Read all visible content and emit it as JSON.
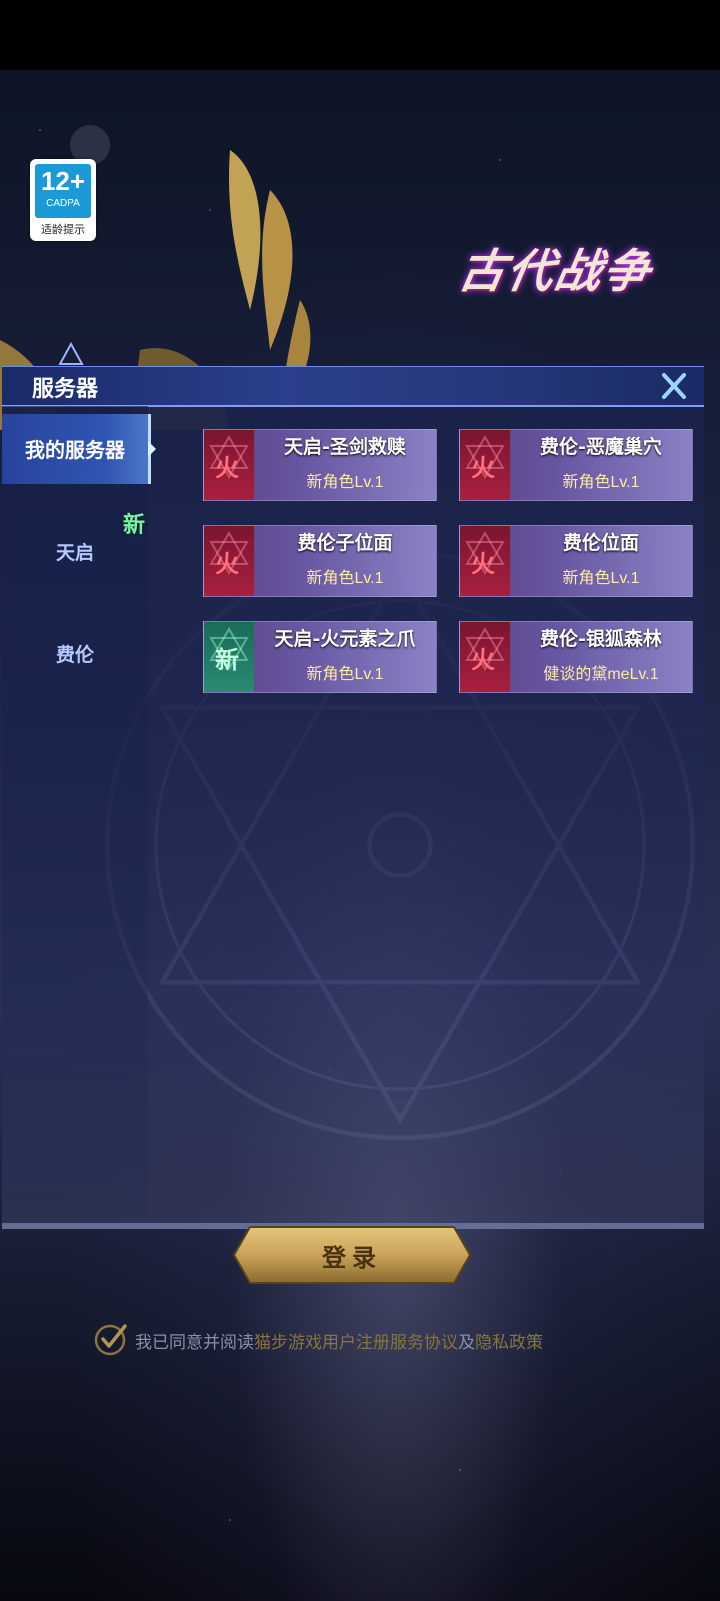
{
  "age_rating": {
    "number": "12+",
    "org": "CADPA",
    "tip": "适龄提示"
  },
  "game_logo": "古代战争",
  "panel": {
    "title": "服务器",
    "sidebar": [
      {
        "label": "我的服务器",
        "active": true
      },
      {
        "label": "天启",
        "active": false
      },
      {
        "label": "费伦",
        "active": false
      }
    ],
    "new_tag": "新",
    "servers": [
      {
        "name": "天启-圣剑救赎",
        "badge": "火",
        "role": "新角色Lv.1"
      },
      {
        "name": "费伦-恶魔巢穴",
        "badge": "火",
        "role": "新角色Lv.1"
      },
      {
        "name": "费伦子位面",
        "badge": "火",
        "role": "新角色Lv.1"
      },
      {
        "name": "费伦位面",
        "badge": "火",
        "role": "新角色Lv.1"
      },
      {
        "name": "天启-火元素之爪",
        "badge": "新",
        "role": "新角色Lv.1"
      },
      {
        "name": "费伦-银狐森林",
        "badge": "火",
        "role": "健谈的黛meLv.1"
      }
    ]
  },
  "login_button": "登录",
  "agreement": {
    "prefix": "我已同意并阅读",
    "user_agreement": "猫步游戏用户注册服务协议",
    "and": "及",
    "privacy": "隐私政策"
  },
  "colors": {
    "fire_badge": "#a8203e",
    "new_badge": "#2a8a72",
    "new_tag": "#7cf2a6",
    "gold": "#c9a35a"
  }
}
